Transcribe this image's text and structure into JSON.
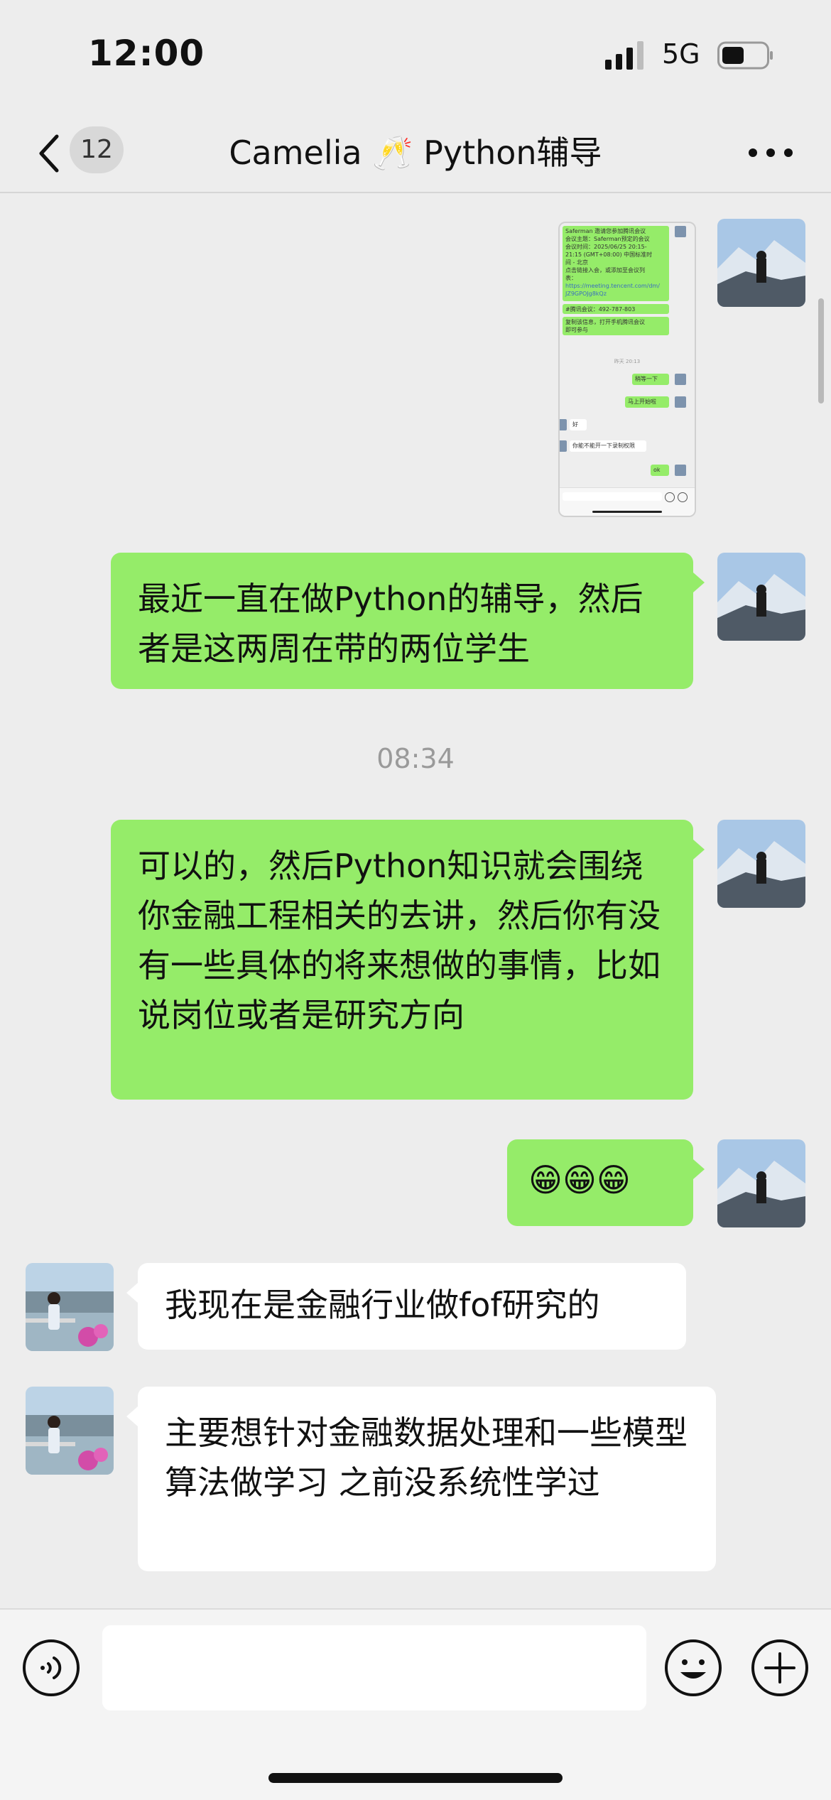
{
  "status_bar": {
    "time": "12:00",
    "network": "5G"
  },
  "nav": {
    "unread_count": "12",
    "title": "Camelia 🥂 Python辅导"
  },
  "screenshot_preview": {
    "lines": [
      "Saferman 邀请您参加腾讯会议",
      "会议主题：Saferman预定的会议",
      "会议时间：2025/06/25 20:15-",
      "21:15 (GMT+08:00) 中国标准时",
      "间 - 北京",
      "点击链接入会，或添加至会议列",
      "表：",
      "https://meeting.tencent.com/dm/",
      "JZ9GPOJg8kQz",
      "#腾讯会议：492-787-803",
      "复制该信息，打开手机腾讯会议",
      "即可参与"
    ],
    "time": "昨天 20:13",
    "msg1": "稍等一下",
    "msg2": "马上开始啦",
    "msg3": "好",
    "msg4": "你能不能开一下录制权限",
    "msg5": "ok"
  },
  "messages": [
    {
      "text": "最近一直在做Python的辅导，然后者是这两周在带的两位学生"
    },
    {
      "text": "可以的，然后Python知识就会围绕你金融工程相关的去讲，然后你有没有一些具体的将来想做的事情，比如说岗位或者是研究方向"
    },
    {
      "text": "😁😁😁"
    },
    {
      "text": "我现在是金融行业做fof研究的"
    },
    {
      "text": "主要想针对金融数据处理和一些模型算法做学习 之前没系统性学过"
    }
  ],
  "timestamp": "08:34",
  "colors": {
    "sent_bubble": "#95ec69",
    "received_bubble": "#ffffff",
    "background": "#ededed"
  },
  "icons": {
    "back": "chevron-left-icon",
    "more": "more-dots-icon",
    "voice": "voice-icon",
    "emoji": "smile-icon",
    "add": "plus-circle-icon"
  }
}
